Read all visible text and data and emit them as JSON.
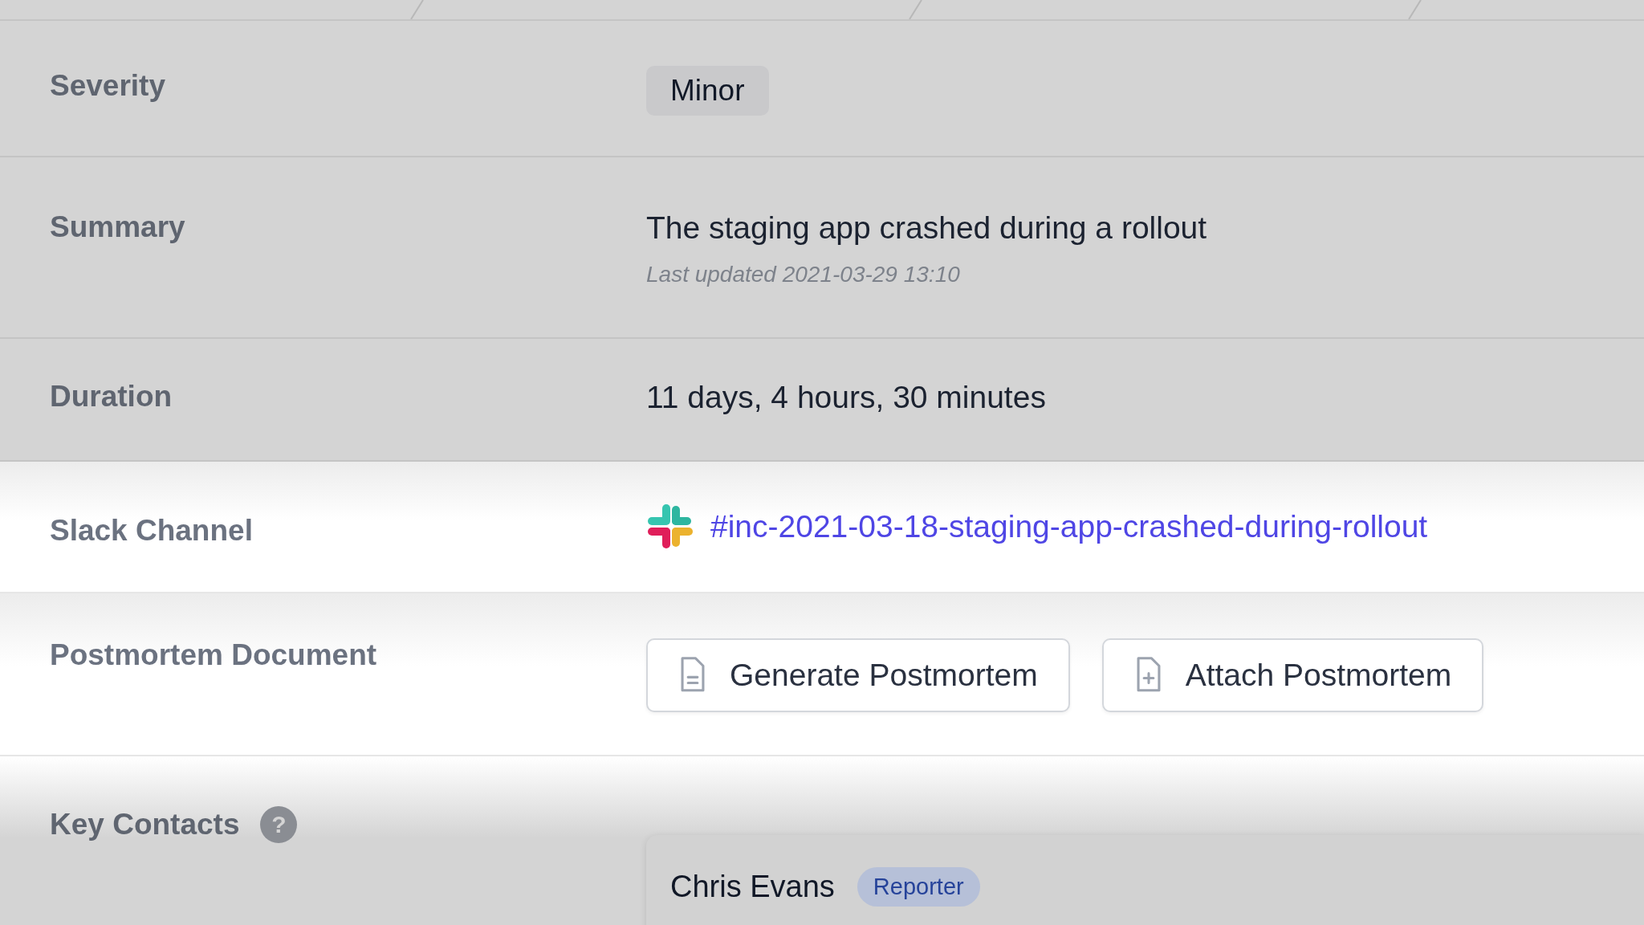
{
  "rows": [
    {
      "kind": "badge",
      "label": "Severity",
      "highlighted": false,
      "value": "Minor"
    },
    {
      "kind": "text",
      "label": "Summary",
      "highlighted": false,
      "value": "The staging app crashed during a rollout",
      "note": "Last updated 2021-03-29 13:10"
    },
    {
      "kind": "text",
      "label": "Duration",
      "highlighted": false,
      "value": "11 days, 4 hours, 30 minutes"
    },
    {
      "kind": "link",
      "label": "Slack Channel",
      "highlighted": true,
      "value": "#inc-2021-03-18-staging-app-crashed-during-rollout"
    },
    {
      "kind": "buttons",
      "label": "Postmortem Document",
      "highlighted": true,
      "buttons": [
        {
          "label": "Generate Postmortem"
        },
        {
          "label": "Attach Postmortem"
        }
      ]
    },
    {
      "kind": "contacts",
      "label": "Key Contacts",
      "highlighted": false,
      "help": "?",
      "contacts": [
        {
          "name": "Chris Evans",
          "role": "Reporter"
        }
      ]
    }
  ]
}
